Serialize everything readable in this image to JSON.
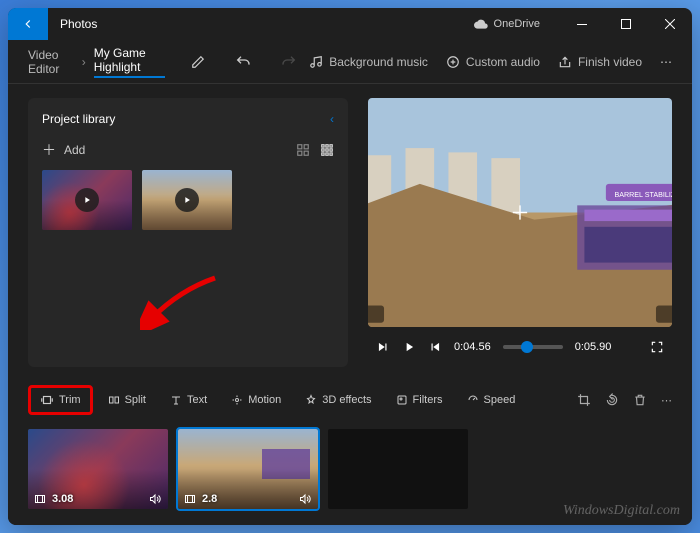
{
  "titlebar": {
    "app_name": "Photos",
    "cloud_label": "OneDrive"
  },
  "toolbar": {
    "video_editor": "Video Editor",
    "project_name": "My Game Highlight",
    "bg_music": "Background music",
    "custom_audio": "Custom audio",
    "finish": "Finish video"
  },
  "library": {
    "title": "Project library",
    "add": "Add"
  },
  "preview": {
    "time_current": "0:04.56",
    "time_total": "0:05.90"
  },
  "timeline": {
    "trim": "Trim",
    "split": "Split",
    "text": "Text",
    "motion": "Motion",
    "effects": "3D effects",
    "filters": "Filters",
    "speed": "Speed",
    "clips": [
      {
        "duration": "3.08"
      },
      {
        "duration": "2.8"
      }
    ]
  },
  "watermark": "WindowsDigital.com"
}
